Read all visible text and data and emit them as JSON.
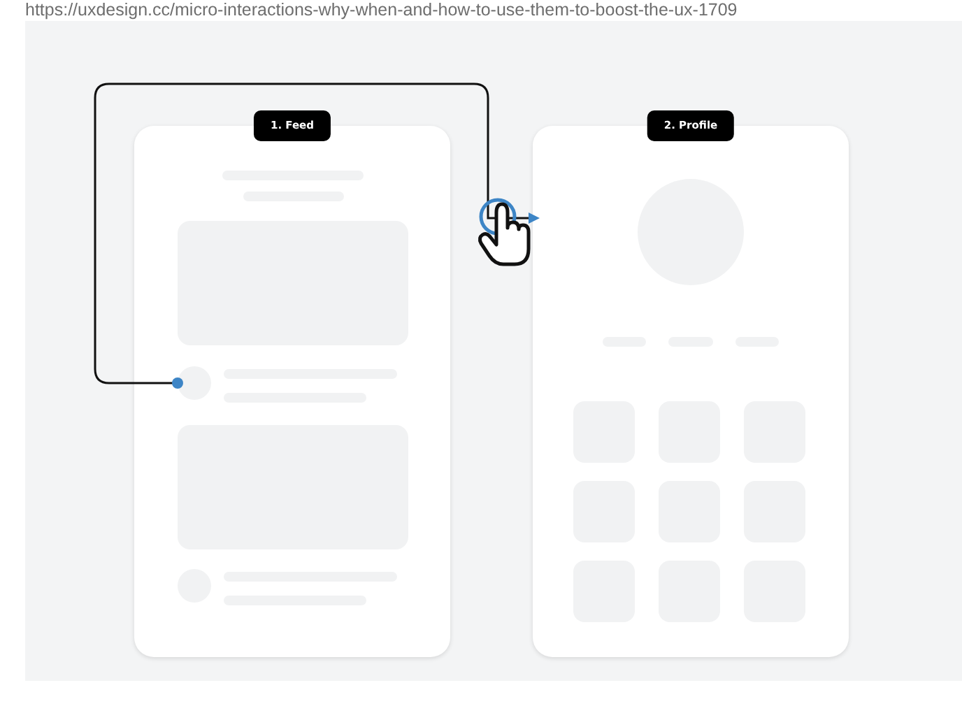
{
  "url": "https://uxdesign.cc/micro-interactions-why-when-and-how-to-use-them-to-boost-the-ux-1709",
  "screens": [
    {
      "label": "1. Feed",
      "kind": "feed"
    },
    {
      "label": "2. Profile",
      "kind": "profile"
    }
  ]
}
